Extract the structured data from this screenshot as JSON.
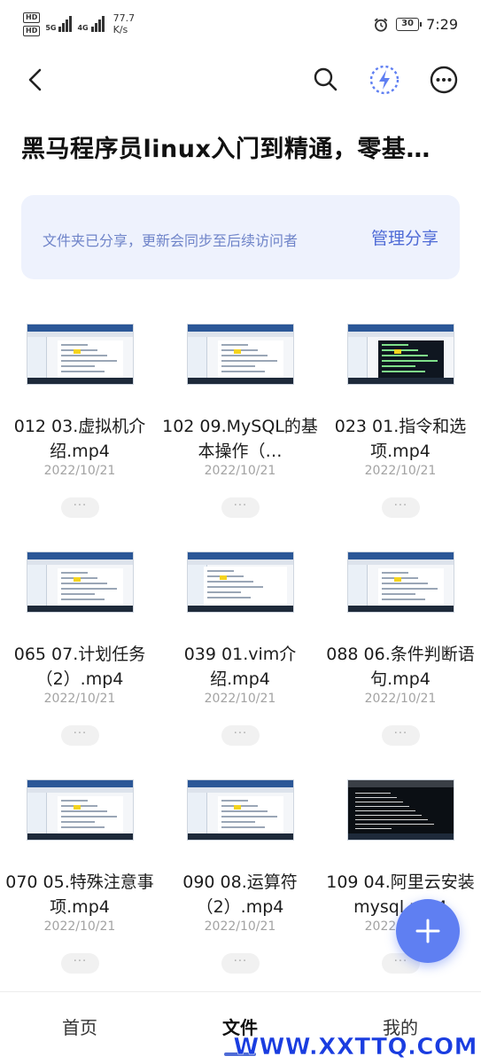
{
  "status_bar": {
    "sim1": "HD",
    "sim2": "HD",
    "net1": "5G",
    "net2": "4G",
    "speed_value": "77.7",
    "speed_unit": "K/s",
    "battery": "30",
    "time": "7:29"
  },
  "header": {
    "title": "黑马程序员linux入门到精通，零基…"
  },
  "banner": {
    "text": "文件夹已分享，更新会同步至后续访问者",
    "action": "管理分享"
  },
  "files": [
    {
      "name": "012 03.虚拟机介绍.mp4",
      "date": "2022/10/21",
      "more": "···",
      "thumb": "doc"
    },
    {
      "name": "102 09.MySQL的基本操作（…",
      "date": "2022/10/21",
      "more": "···",
      "thumb": "doc"
    },
    {
      "name": "023 01.指令和选项.mp4",
      "date": "2022/10/21",
      "more": "···",
      "thumb": "dark"
    },
    {
      "name": "065 07.计划任务（2）.mp4",
      "date": "2022/10/21",
      "more": "···",
      "thumb": "doc"
    },
    {
      "name": "039 01.vim介绍.mp4",
      "date": "2022/10/21",
      "more": "···",
      "thumb": "wide"
    },
    {
      "name": "088 06.条件判断语句.mp4",
      "date": "2022/10/21",
      "more": "···",
      "thumb": "doc"
    },
    {
      "name": "070 05.特殊注意事项.mp4",
      "date": "2022/10/21",
      "more": "···",
      "thumb": "doc"
    },
    {
      "name": "090 08.运算符（2）.mp4",
      "date": "2022/10/21",
      "more": "···",
      "thumb": "doc"
    },
    {
      "name": "109 04.阿里云安装mysql.mp4",
      "date": "2022/10/21",
      "more": "···",
      "thumb": "term"
    }
  ],
  "bottom_nav": {
    "home": "首页",
    "files": "文件",
    "me": "我的"
  },
  "watermark": "WWW.XXTTQ.COM",
  "colors": {
    "accent": "#4f6bd6",
    "fab": "#5f7ff2",
    "banner_bg": "#eef2fd"
  }
}
